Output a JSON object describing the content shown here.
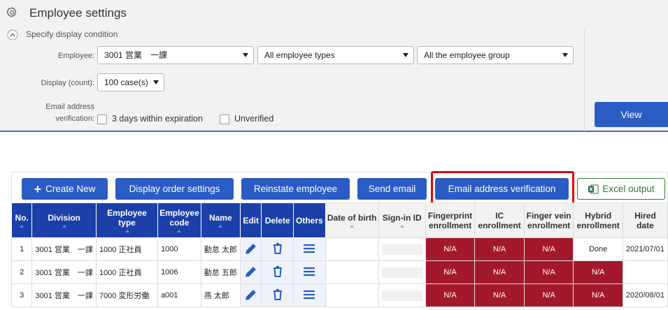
{
  "header": {
    "title": "Employee settings",
    "icon": "gear-icon"
  },
  "conditions": {
    "title": "Specify display condition",
    "employee_label": "Employee:",
    "employee_value": "3001 営業　一課",
    "employee_type_value": "All employee types",
    "employee_group_value": "All the employee group",
    "display_count_label": "Display (count):",
    "display_count_value": "100 case(s)",
    "email_verification_label_1": "Email address",
    "email_verification_label_2": "verification:",
    "option_3days": "3 days within expiration",
    "option_unverified": "Unverified",
    "view_button": "View"
  },
  "toolbar": {
    "create_new": "Create New",
    "display_order": "Display order settings",
    "reinstate": "Reinstate employee",
    "send_email": "Send email",
    "email_verification": "Email address verification",
    "excel_output": "Excel output"
  },
  "table": {
    "headers": {
      "no": "No.",
      "division": "Division",
      "employee_type": "Employee type",
      "employee_code_1": "Employee",
      "employee_code_2": "code",
      "name": "Name",
      "edit": "Edit",
      "delete": "Delete",
      "others": "Others",
      "dob": "Date of birth",
      "signin": "Sign-in ID",
      "fingerprint_1": "Fingerprint",
      "fingerprint_2": "enrollment",
      "ic_1": "IC",
      "ic_2": "enrollment",
      "fingervein_1": "Finger vein",
      "fingervein_2": "enrollment",
      "hybrid_1": "Hybrid",
      "hybrid_2": "enrollment",
      "hired_1": "Hired",
      "hired_2": "date"
    },
    "rows": [
      {
        "no": "1",
        "division": "3001 営業　一課",
        "type": "1000 正社員",
        "code": "1000",
        "name": "勤怠 太郎",
        "dob": "",
        "fingerprint": "N/A",
        "ic": "N/A",
        "vein": "N/A",
        "hybrid": "Done",
        "hired": "2021/07/01"
      },
      {
        "no": "2",
        "division": "3001 営業　一課",
        "type": "1000 正社員",
        "code": "1006",
        "name": "勤怠 五郎",
        "dob": "",
        "fingerprint": "N/A",
        "ic": "N/A",
        "vein": "N/A",
        "hybrid": "N/A",
        "hired": ""
      },
      {
        "no": "3",
        "division": "3001 営業　一課",
        "type": "7000 変形労働",
        "code": "a001",
        "name": "燕 太郎",
        "dob": "",
        "fingerprint": "N/A",
        "ic": "N/A",
        "vein": "N/A",
        "hybrid": "N/A",
        "hired": "2020/08/01"
      }
    ]
  },
  "colors": {
    "primary": "#2b5cc4",
    "header": "#1c3fa8",
    "na": "#a3192b",
    "highlight": "#e60000",
    "excel": "#2e7d32"
  }
}
